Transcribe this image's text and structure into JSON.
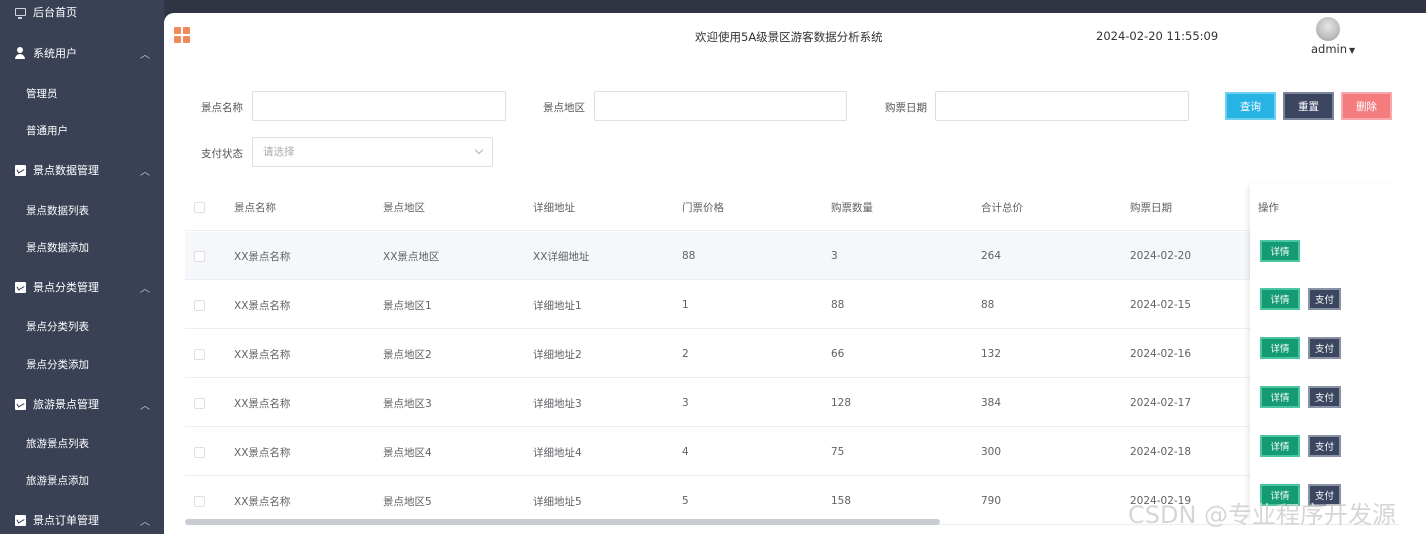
{
  "sidebar": {
    "home": "后台首页",
    "groups": [
      {
        "label": "系统用户",
        "items": [
          "管理员",
          "普通用户"
        ]
      },
      {
        "label": "景点数据管理",
        "items": [
          "景点数据列表",
          "景点数据添加"
        ]
      },
      {
        "label": "景点分类管理",
        "items": [
          "景点分类列表",
          "景点分类添加"
        ]
      },
      {
        "label": "旅游景点管理",
        "items": [
          "旅游景点列表",
          "旅游景点添加"
        ]
      },
      {
        "label": "景点订单管理",
        "items": []
      }
    ]
  },
  "header": {
    "title": "欢迎使用5A级景区游客数据分析系统",
    "datetime": "2024-02-20 11:55:09",
    "user": "admin"
  },
  "search": {
    "name_label": "景点名称",
    "area_label": "景点地区",
    "date_label": "购票日期",
    "pay_label": "支付状态",
    "pay_placeholder": "请选择",
    "query": "查询",
    "reset": "重置",
    "delete": "删除"
  },
  "table": {
    "columns": [
      "景点名称",
      "景点地区",
      "详细地址",
      "门票价格",
      "购票数量",
      "合计总价",
      "购票日期",
      "操作"
    ],
    "rows": [
      [
        "XX景点名称",
        "XX景点地区",
        "XX详细地址",
        "88",
        "3",
        "264",
        "2024-02-20"
      ],
      [
        "XX景点名称",
        "景点地区1",
        "详细地址1",
        "1",
        "88",
        "88",
        "2024-02-15"
      ],
      [
        "XX景点名称",
        "景点地区2",
        "详细地址2",
        "2",
        "66",
        "132",
        "2024-02-16"
      ],
      [
        "XX景点名称",
        "景点地区3",
        "详细地址3",
        "3",
        "128",
        "384",
        "2024-02-17"
      ],
      [
        "XX景点名称",
        "景点地区4",
        "详细地址4",
        "4",
        "75",
        "300",
        "2024-02-18"
      ],
      [
        "XX景点名称",
        "景点地区5",
        "详细地址5",
        "5",
        "158",
        "790",
        "2024-02-19"
      ]
    ],
    "detail_label": "详情",
    "pay_label": "支付"
  },
  "watermark": "CSDN @专业程序开发源"
}
